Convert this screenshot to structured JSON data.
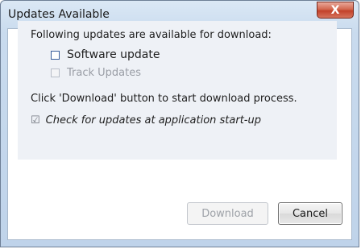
{
  "window": {
    "title": "Updates Available",
    "close_label": "X"
  },
  "panel": {
    "heading": "Following updates are available for download:",
    "options": [
      {
        "label": "Software update",
        "checked": false,
        "enabled": true
      },
      {
        "label": "Track Updates",
        "checked": false,
        "enabled": false
      }
    ],
    "instruction": "Click 'Download' button to start download process.",
    "startup_check": {
      "label": "Check for updates at application start-up",
      "checked": true,
      "enabled": false
    }
  },
  "buttons": {
    "download_label": "Download",
    "cancel_label": "Cancel"
  }
}
